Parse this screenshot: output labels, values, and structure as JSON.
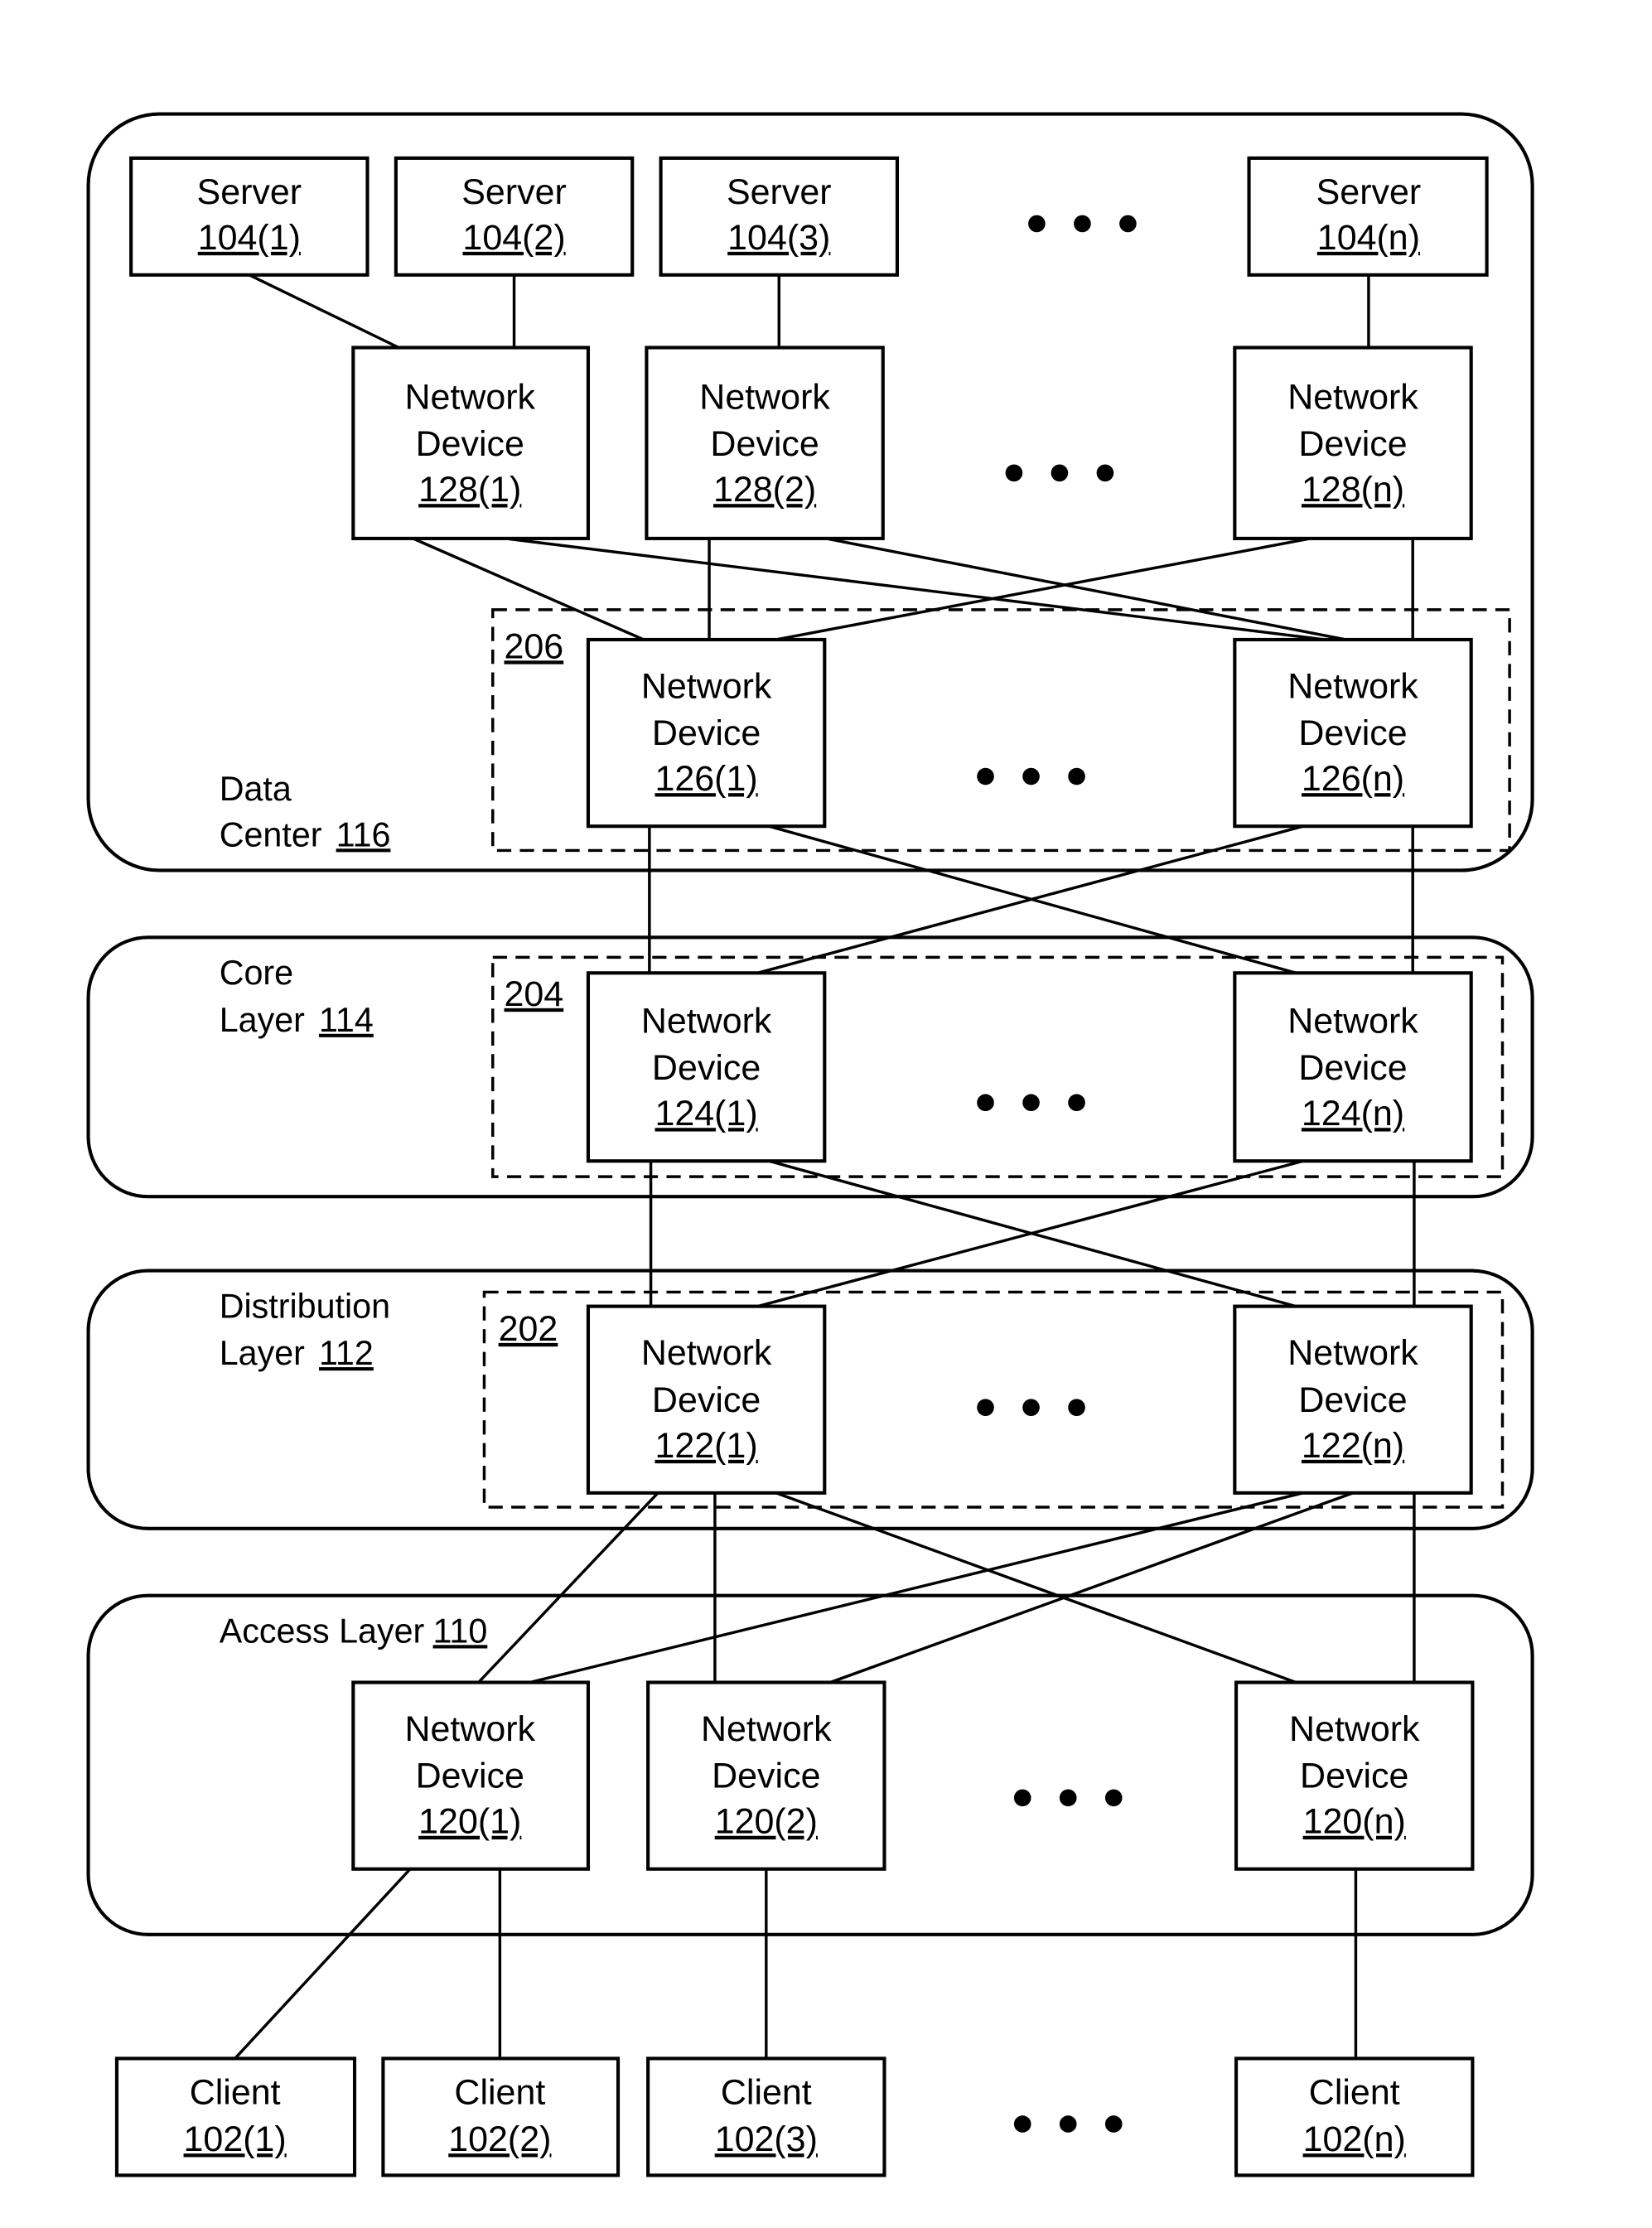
{
  "figure": {
    "data_center": {
      "name": "Data Center",
      "ref": "116"
    },
    "core_layer": {
      "name": "Core Layer",
      "line1": "Core",
      "line2": "Layer",
      "ref": "114"
    },
    "distribution_layer": {
      "line1": "Distribution",
      "line2": "Layer",
      "ref": "112"
    },
    "access_layer": {
      "name": "Access Layer",
      "ref": "110"
    },
    "groups": {
      "g206": "206",
      "g204": "204",
      "g202": "202"
    },
    "servers": [
      {
        "label": "Server",
        "ref": "104(1)"
      },
      {
        "label": "Server",
        "ref": "104(2)"
      },
      {
        "label": "Server",
        "ref": "104(3)"
      },
      {
        "label": "Server",
        "ref": "104(n)"
      }
    ],
    "nd128": [
      {
        "line1": "Network",
        "line2": "Device",
        "ref": "128(1)"
      },
      {
        "line1": "Network",
        "line2": "Device",
        "ref": "128(2)"
      },
      {
        "line1": "Network",
        "line2": "Device",
        "ref": "128(n)"
      }
    ],
    "nd126": [
      {
        "line1": "Network",
        "line2": "Device",
        "ref": "126(1)"
      },
      {
        "line1": "Network",
        "line2": "Device",
        "ref": "126(n)"
      }
    ],
    "nd124": [
      {
        "line1": "Network",
        "line2": "Device",
        "ref": "124(1)"
      },
      {
        "line1": "Network",
        "line2": "Device",
        "ref": "124(n)"
      }
    ],
    "nd122": [
      {
        "line1": "Network",
        "line2": "Device",
        "ref": "122(1)"
      },
      {
        "line1": "Network",
        "line2": "Device",
        "ref": "122(n)"
      }
    ],
    "nd120": [
      {
        "line1": "Network",
        "line2": "Device",
        "ref": "120(1)"
      },
      {
        "line1": "Network",
        "line2": "Device",
        "ref": "120(2)"
      },
      {
        "line1": "Network",
        "line2": "Device",
        "ref": "120(n)"
      }
    ],
    "clients": [
      {
        "label": "Client",
        "ref": "102(1)"
      },
      {
        "label": "Client",
        "ref": "102(2)"
      },
      {
        "label": "Client",
        "ref": "102(3)"
      },
      {
        "label": "Client",
        "ref": "102(n)"
      }
    ],
    "ellipsis": "more devices"
  }
}
